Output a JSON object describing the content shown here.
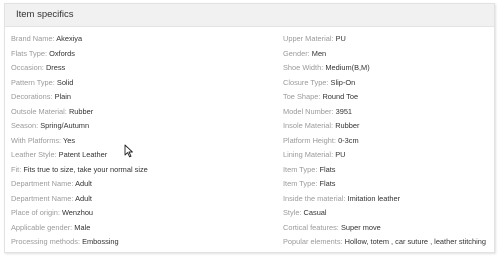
{
  "header": {
    "title": "Item specifics"
  },
  "left_specs": [
    {
      "label": "Brand Name:",
      "value": "Akexiya"
    },
    {
      "label": "Flats Type:",
      "value": "Oxfords"
    },
    {
      "label": "Occasion:",
      "value": "Dress"
    },
    {
      "label": "Pattern Type:",
      "value": "Solid"
    },
    {
      "label": "Decorations:",
      "value": "Plain"
    },
    {
      "label": "Outsole Material:",
      "value": "Rubber"
    },
    {
      "label": "Season:",
      "value": "Spring/Autumn"
    },
    {
      "label": "With Platforms:",
      "value": "Yes"
    },
    {
      "label": "Leather Style:",
      "value": "Patent Leather"
    },
    {
      "label": "Fit:",
      "value": "Fits true to size, take your normal size"
    },
    {
      "label": "Department Name:",
      "value": "Adult"
    },
    {
      "label": "Department Name:",
      "value": "Adult"
    },
    {
      "label": "Place of origin:",
      "value": "Wenzhou"
    },
    {
      "label": "Applicable gender:",
      "value": "Male"
    },
    {
      "label": "Processing methods:",
      "value": "Embossing"
    }
  ],
  "right_specs": [
    {
      "label": "Upper Material:",
      "value": "PU"
    },
    {
      "label": "Gender:",
      "value": "Men"
    },
    {
      "label": "Shoe Width:",
      "value": "Medium(B,M)"
    },
    {
      "label": "Closure Type:",
      "value": "Slip-On"
    },
    {
      "label": "Toe Shape:",
      "value": "Round Toe"
    },
    {
      "label": "Model Number:",
      "value": "3951"
    },
    {
      "label": "Insole Material:",
      "value": "Rubber"
    },
    {
      "label": "Platform Height:",
      "value": "0-3cm"
    },
    {
      "label": "Lining Material:",
      "value": "PU"
    },
    {
      "label": "Item Type:",
      "value": "Flats"
    },
    {
      "label": "Item Type:",
      "value": "Flats"
    },
    {
      "label": "Inside the material:",
      "value": "Imitation leather"
    },
    {
      "label": "Style:",
      "value": "Casual"
    },
    {
      "label": "Cortical features:",
      "value": "Super move"
    },
    {
      "label": "Popular elements:",
      "value": "Hollow, totem , car suture , leather stitching"
    }
  ],
  "cursor": {
    "icon": "mouse-pointer-icon"
  }
}
